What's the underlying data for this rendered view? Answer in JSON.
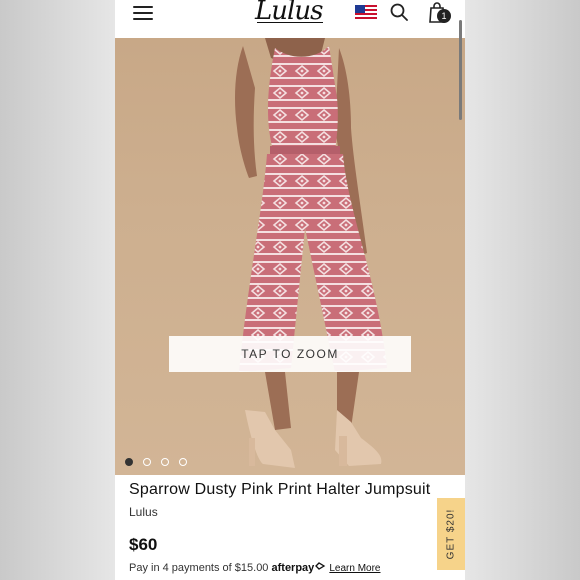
{
  "header": {
    "logo_text": "Lulus",
    "cart_count": "1",
    "icons": [
      "menu-icon",
      "us-flag-icon",
      "search-icon",
      "shopping-bag-icon"
    ]
  },
  "gallery": {
    "zoom_label": "TAP TO ZOOM",
    "slide_count": 4,
    "active_slide": 1
  },
  "product": {
    "title": "Sparrow Dusty Pink Print Halter Jumpsuit",
    "brand": "Lulus",
    "price": "$60",
    "installment_text": "Pay in 4 payments of $15.00",
    "afterpay_label": "afterpay",
    "learn_more_label": "Learn More"
  },
  "promo": {
    "label": "GET $20!"
  },
  "colors": {
    "jumpsuit_pink": "#c96e78",
    "background_tan": "#c8a887",
    "promo_yellow": "#f6d38a"
  }
}
